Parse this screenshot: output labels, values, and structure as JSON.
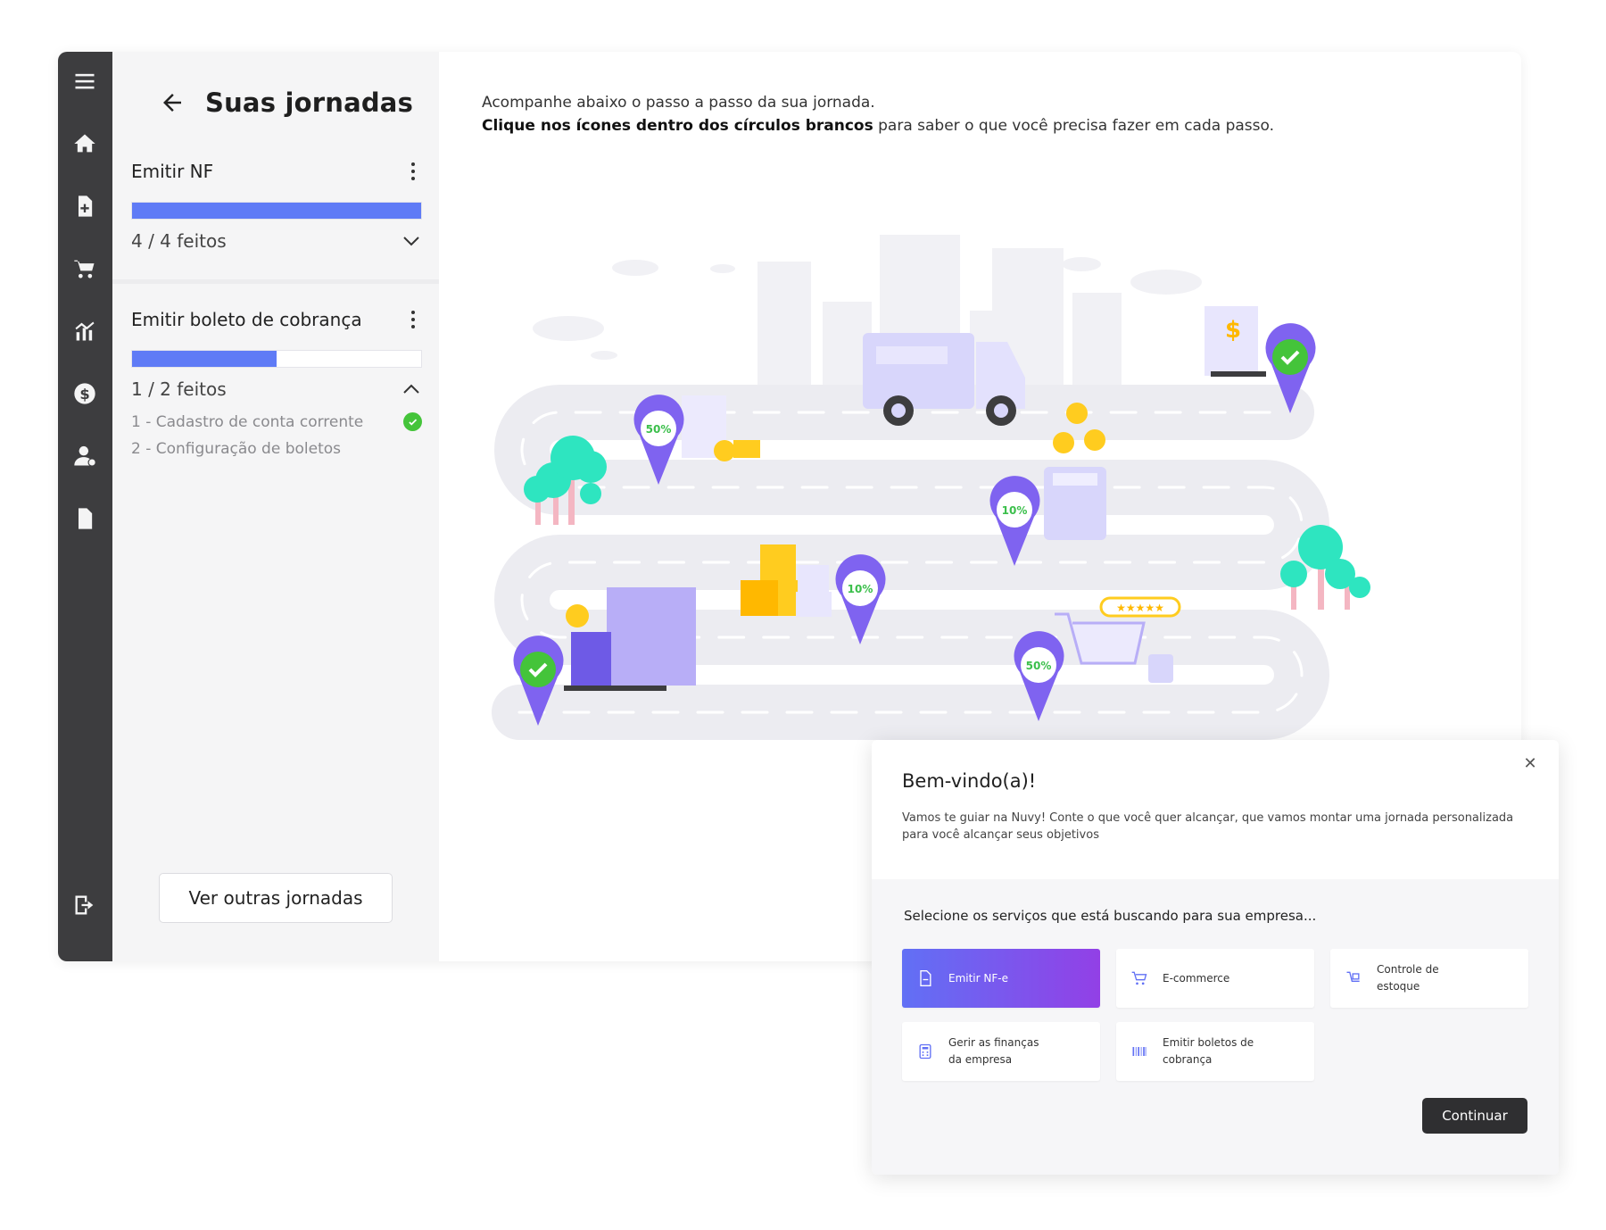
{
  "sidebar": {
    "title": "Suas jornadas",
    "journeys": [
      {
        "name": "Emitir NF",
        "progress_text": "4 / 4 feitos",
        "progress": 1.0
      },
      {
        "name": "Emitir boleto de cobrança",
        "progress_text": "1 / 2 feitos",
        "progress": 0.5,
        "steps": [
          {
            "label": "1 - Cadastro de conta corrente",
            "done": true
          },
          {
            "label": "2 - Configuração de boletos",
            "done": false
          }
        ]
      }
    ],
    "more_button": "Ver outras jornadas"
  },
  "nav_icons": [
    "menu-icon",
    "home-icon",
    "add-document-icon",
    "cart-icon",
    "chart-icon",
    "money-icon",
    "user-icon",
    "document-icon",
    "logout-icon"
  ],
  "main": {
    "intro_line1": "Acompanhe abaixo o passo a passo da sua jornada.",
    "intro_bold": "Clique nos ícones dentro dos círculos brancos",
    "intro_rest": " para saber o que você precisa fazer em cada passo.",
    "map_markers": [
      {
        "label": "50%",
        "status": "progress"
      },
      {
        "label": "10%",
        "status": "progress"
      },
      {
        "label": "10%",
        "status": "progress"
      },
      {
        "label": "50%",
        "status": "progress"
      },
      {
        "label": "",
        "status": "done"
      },
      {
        "label": "",
        "status": "done"
      }
    ]
  },
  "modal": {
    "title": "Bem-vindo(a)!",
    "description": "Vamos te guiar na Nuvy! Conte o que você quer alcançar, que vamos montar uma jornada personalizada para você alcançar seus objetivos",
    "question": "Selecione os serviços que está buscando para sua empresa...",
    "options": [
      {
        "label": "Emitir NF-e",
        "icon": "document-icon",
        "selected": true
      },
      {
        "label": "E-commerce",
        "icon": "cart-icon",
        "selected": false
      },
      {
        "label": "Controle de estoque",
        "icon": "inventory-icon",
        "selected": false
      },
      {
        "label": "Gerir as finanças da empresa",
        "icon": "calculator-icon",
        "selected": false
      },
      {
        "label": "Emitir boletos de cobrança",
        "icon": "barcode-icon",
        "selected": false
      }
    ],
    "continue_button": "Continuar"
  },
  "colors": {
    "accent": "#5f7bf6",
    "sidebar_bg": "#3d3d3f",
    "success": "#44c43a",
    "marker": "#7f63f0",
    "gradient_start": "#6170f5",
    "gradient_end": "#9240e6"
  }
}
